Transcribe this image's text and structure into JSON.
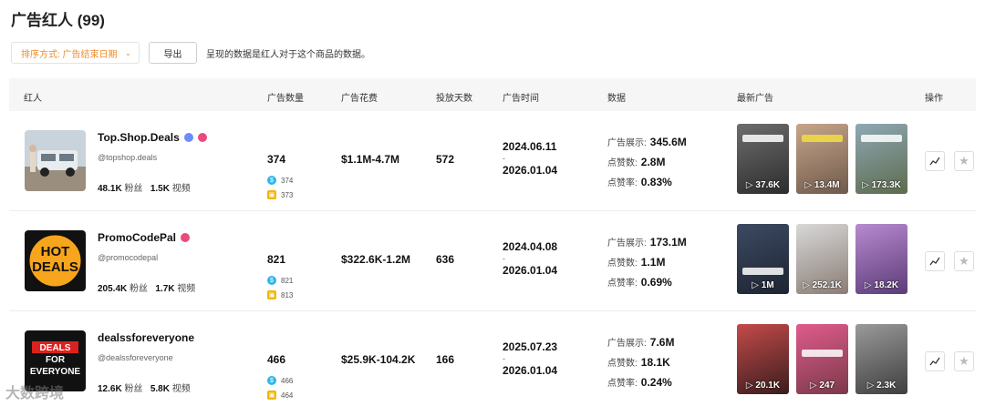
{
  "page": {
    "title": "广告红人 (99)"
  },
  "toolbar": {
    "sort_label": "排序方式: 广告结束日期",
    "export_label": "导出",
    "hint": "呈现的数据是红人对于这个商品的数据。"
  },
  "columns": {
    "influencer": "红人",
    "ad_count": "广告数量",
    "ad_spend": "广告花费",
    "days": "投放天数",
    "ad_time": "广告时间",
    "data": "数据",
    "latest_ads": "最新广告",
    "actions": "操作"
  },
  "labels": {
    "fans": "粉丝",
    "videos": "视频",
    "impressions": "广告展示:",
    "likes": "点赞数:",
    "like_rate": "点赞率:",
    "dash": "-"
  },
  "colors": {
    "accent": "#f08c2a",
    "blue_icon": "#2fb6e7",
    "yellow_icon": "#f5b400"
  },
  "rows": [
    {
      "name": "Top.Shop.Deals",
      "handle": "@topshop.deals",
      "fans": "48.1K",
      "videos": "1.5K",
      "ad_count": "374",
      "sub1": "374",
      "sub2": "373",
      "spend": "$1.1M-4.7M",
      "days": "572",
      "start": "2024.06.11",
      "end": "2026.01.04",
      "impressions": "345.6M",
      "likes": "2.8M",
      "like_rate": "0.83%",
      "thumb_views": [
        "37.6K",
        "13.4M",
        "173.3K"
      ]
    },
    {
      "name": "PromoCodePal",
      "handle": "@promocodepal",
      "fans": "205.4K",
      "videos": "1.7K",
      "ad_count": "821",
      "sub1": "821",
      "sub2": "813",
      "spend": "$322.6K-1.2M",
      "days": "636",
      "start": "2024.04.08",
      "end": "2026.01.04",
      "impressions": "173.1M",
      "likes": "1.1M",
      "like_rate": "0.69%",
      "thumb_views": [
        "1M",
        "252.1K",
        "18.2K"
      ],
      "avatar_text": [
        "HOT",
        "DEALS"
      ]
    },
    {
      "name": "dealssforeveryone",
      "handle": "@dealssforeveryone",
      "fans": "12.6K",
      "videos": "5.8K",
      "ad_count": "466",
      "sub1": "466",
      "sub2": "464",
      "spend": "$25.9K-104.2K",
      "days": "166",
      "start": "2025.07.23",
      "end": "2026.01.04",
      "impressions": "7.6M",
      "likes": "18.1K",
      "like_rate": "0.24%",
      "thumb_views": [
        "20.1K",
        "247",
        "2.3K"
      ],
      "avatar_text": [
        "DEALS",
        "FOR",
        "EVERYONE"
      ]
    }
  ],
  "watermark": "大数跨境"
}
